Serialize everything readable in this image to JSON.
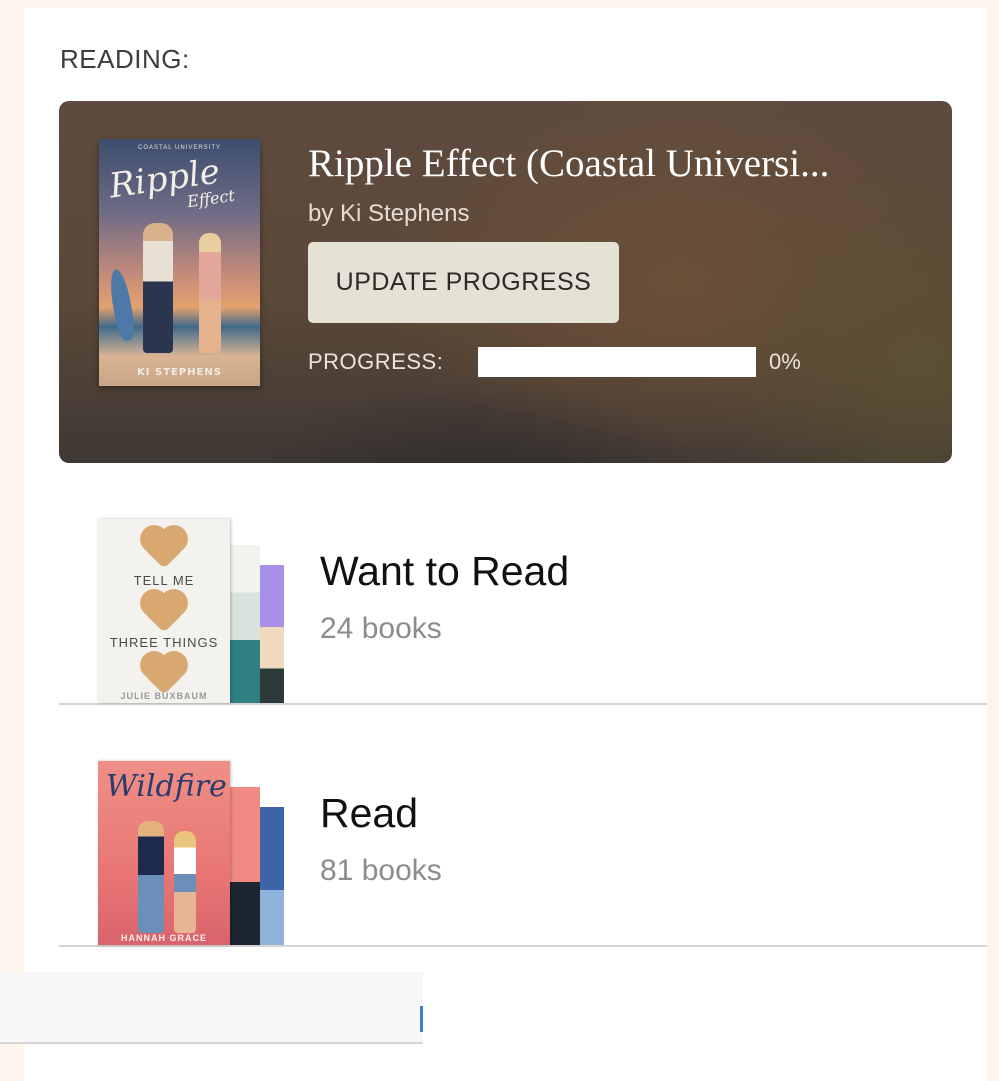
{
  "reading": {
    "heading": "READING:",
    "book": {
      "title": "Ripple Effect (Coastal Universi...",
      "author_line": "by Ki Stephens",
      "cover": {
        "series_line": "COASTAL UNIVERSITY",
        "title_script": "Ripple",
        "title_sub": "Effect",
        "author": "KI STEPHENS"
      }
    },
    "update_button_label": "UPDATE PROGRESS",
    "progress_label": "PROGRESS:",
    "progress_percent_text": "0%",
    "progress_value": 0
  },
  "shelves": [
    {
      "name": "Want to Read",
      "count": "24 books",
      "front_cover": {
        "line1": "TELL ME",
        "line2": "THREE THINGS",
        "author": "JULIE BUXBAUM"
      }
    },
    {
      "name": "Read",
      "count": "81 books",
      "front_cover": {
        "title_script": "Wildfire",
        "author": "HANNAH GRACE"
      }
    }
  ],
  "colors": {
    "card_brown": "#5e4b3f",
    "button_bg": "#e4e1d5",
    "page_bg": "#fdf5ec",
    "divider": "#d4d4d4"
  }
}
